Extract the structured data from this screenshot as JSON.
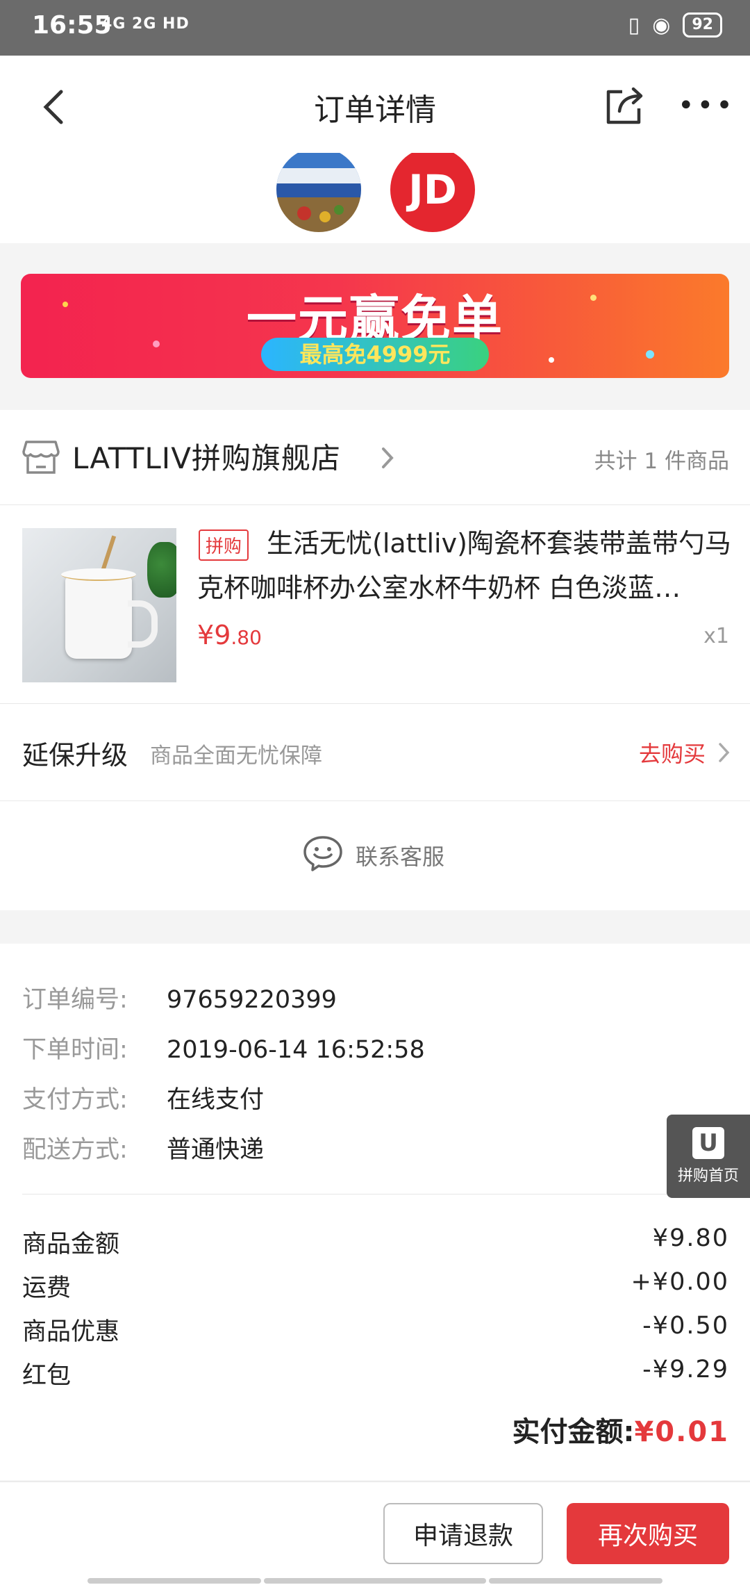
{
  "status_bar": {
    "time": "16:55",
    "network": "4G  2G  HD",
    "battery": "92"
  },
  "header": {
    "title": "订单详情"
  },
  "avatars": {
    "jd_text": "JD"
  },
  "banner": {
    "title": "一元赢免单",
    "subtitle": "最高免4999元"
  },
  "store": {
    "name": "LATTLIV拼购旗舰店",
    "count": "共计 1 件商品"
  },
  "product": {
    "tag": "拼购",
    "title": "生活无忧(lattliv)陶瓷杯套装带盖带勺马克杯咖啡杯办公室水杯牛奶杯 白色淡蓝…",
    "price_symbol": "¥",
    "price_int": "9",
    "price_dec": ".80",
    "qty": "x1"
  },
  "warranty": {
    "title": "延保升级",
    "desc": "商品全面无忧保障",
    "action": "去购买"
  },
  "service": {
    "label": "联系客服"
  },
  "order_info": {
    "number_label": "订单编号:",
    "number": "97659220399",
    "time_label": "下单时间:",
    "time": "2019-06-14 16:52:58",
    "pay_label": "支付方式:",
    "pay": "在线支付",
    "ship_label": "配送方式:",
    "ship": "普通快递"
  },
  "fees": {
    "goods_label": "商品金额",
    "goods": "¥9.80",
    "shipping_label": "运费",
    "shipping": "+¥0.00",
    "discount_label": "商品优惠",
    "discount": "-¥0.50",
    "redpacket_label": "红包",
    "redpacket": "-¥9.29"
  },
  "total": {
    "label": "实付金额:",
    "amount": "¥0.01"
  },
  "float_home": {
    "label": "拼购首页"
  },
  "actions": {
    "refund": "申请退款",
    "rebuy": "再次购买"
  },
  "colors": {
    "accent": "#e4393c",
    "status_bar": "#6b6b6b"
  }
}
